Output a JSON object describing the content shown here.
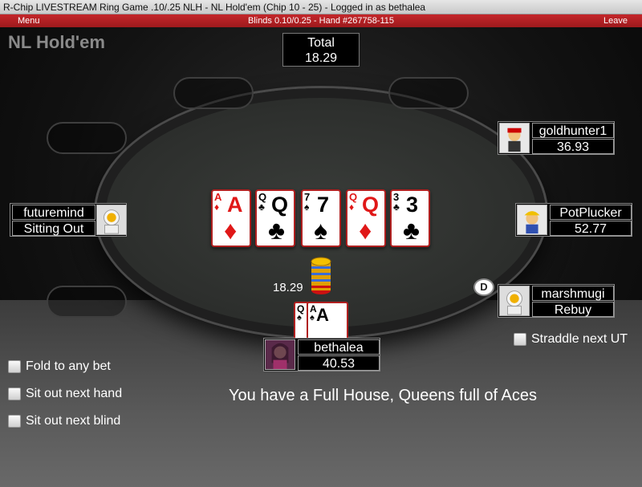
{
  "window": {
    "title": "R-Chip LIVESTREAM Ring Game .10/.25 NLH - NL Hold'em (Chip 10 - 25) - Logged in as bethalea"
  },
  "menubar": {
    "menu_label": "Menu",
    "blinds_info": "Blinds 0.10/0.25 - Hand #267758-115",
    "leave_label": "Leave"
  },
  "table": {
    "game_name": "NL Hold'em",
    "total_label": "Total",
    "total_value": "18.29",
    "pot_amount": "18.29",
    "dealer_button": "D"
  },
  "board_cards": [
    {
      "rank": "A",
      "suit": "♦",
      "color": "red"
    },
    {
      "rank": "Q",
      "suit": "♣",
      "color": "black"
    },
    {
      "rank": "7",
      "suit": "♠",
      "color": "black"
    },
    {
      "rank": "Q",
      "suit": "♦",
      "color": "red"
    },
    {
      "rank": "3",
      "suit": "♣",
      "color": "black"
    }
  ],
  "hero_cards": [
    {
      "rank": "Q",
      "suit": "♠",
      "color": "black"
    },
    {
      "rank": "A",
      "suit": "♠",
      "color": "black"
    }
  ],
  "players": {
    "goldhunter1": {
      "name": "goldhunter1",
      "status": "36.93",
      "avatar": "miner-avatar-icon"
    },
    "futuremind": {
      "name": "futuremind",
      "status": "Sitting Out",
      "avatar": "astronaut-avatar-icon"
    },
    "potplucker": {
      "name": "PotPlucker",
      "status": "52.77",
      "avatar": "hardhat-avatar-icon"
    },
    "marshmugi": {
      "name": "marshmugi",
      "status": "Rebuy",
      "avatar": "astronaut-avatar-icon"
    },
    "bethalea": {
      "name": "bethalea",
      "status": "40.53",
      "avatar": "photo-avatar-icon"
    }
  },
  "options": {
    "fold_any": "Fold to any bet",
    "sit_out_hand": "Sit out next hand",
    "sit_out_blind": "Sit out next blind",
    "straddle": "Straddle next UT"
  },
  "hand_message": "You have a Full House, Queens full of Aces",
  "colors": {
    "card_border": "#b02020",
    "menubar": "#b02126",
    "table_felt": "#2f312f"
  }
}
